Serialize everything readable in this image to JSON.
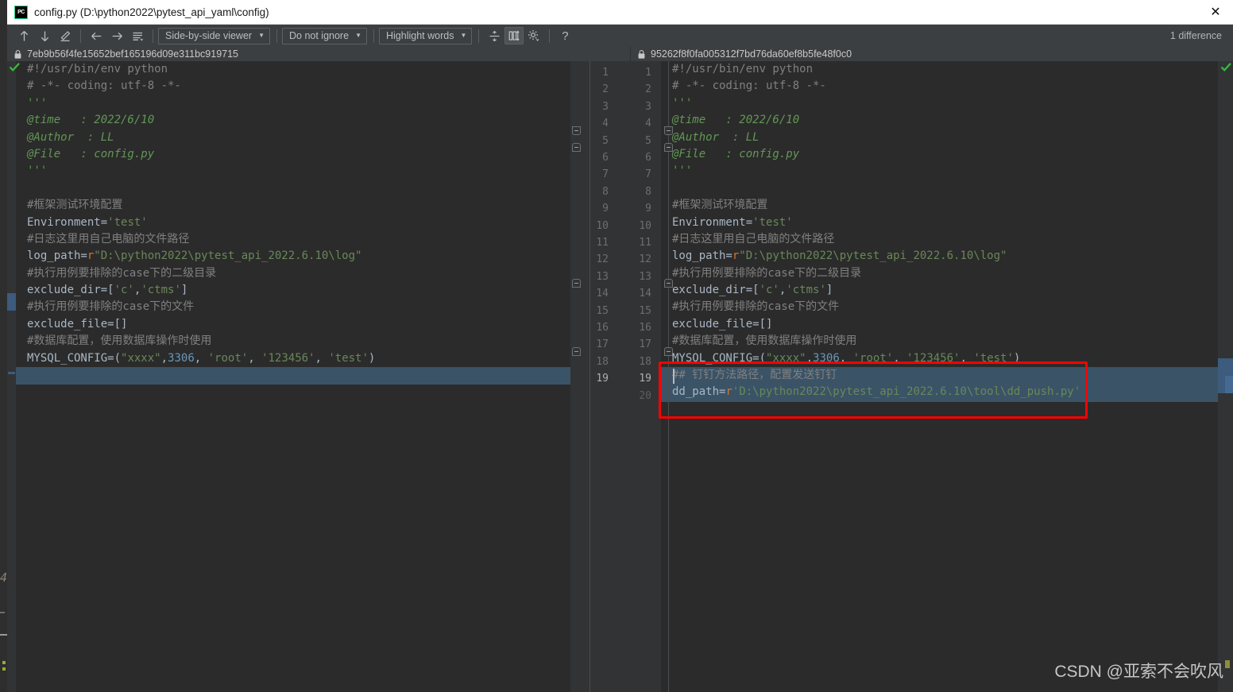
{
  "window": {
    "app_icon": "pycharm-icon",
    "title": "config.py (D:\\python2022\\pytest_api_yaml\\config)",
    "close_label": "✕"
  },
  "toolbar": {
    "prev_diff_icon": "arrow-up-icon",
    "next_diff_icon": "arrow-down-icon",
    "edit_icon": "pencil-icon",
    "accept_left_icon": "arrow-left-icon",
    "accept_right_icon": "arrow-right-icon",
    "lines_icon": "align-lines-icon",
    "viewer_mode": "Side-by-side viewer",
    "ignore_mode": "Do not ignore",
    "highlight_mode": "Highlight words",
    "collapse_icon": "collapse-unchanged-icon",
    "sync_scroll_icon": "synchronize-scroll-icon",
    "settings_icon": "gear-icon",
    "help_icon": "help-question-icon",
    "difference_count": "1 difference"
  },
  "panes": {
    "left": {
      "lock_icon": "lock-icon",
      "revision": "7eb9b56f4fe15652bef165196d09e311bc919715",
      "status_icon": "green-check-icon",
      "lines": [
        {
          "n": 1,
          "tokens": [
            {
              "t": "#!/usr/bin/env python",
              "c": "cmt"
            }
          ]
        },
        {
          "n": 2,
          "tokens": [
            {
              "t": "# -*- coding: utf-8 -*-",
              "c": "cmt"
            }
          ]
        },
        {
          "n": 3,
          "tokens": [
            {
              "t": "'''",
              "c": "doc"
            }
          ]
        },
        {
          "n": 4,
          "tokens": [
            {
              "t": "@time   : 2022/6/10",
              "c": "doc"
            }
          ]
        },
        {
          "n": 5,
          "tokens": [
            {
              "t": "@Author  : LL",
              "c": "doc"
            }
          ]
        },
        {
          "n": 6,
          "tokens": [
            {
              "t": "@File   : config.py",
              "c": "doc"
            }
          ]
        },
        {
          "n": 7,
          "tokens": [
            {
              "t": "'''",
              "c": "doc"
            }
          ]
        },
        {
          "n": 8,
          "tokens": []
        },
        {
          "n": 9,
          "tokens": [
            {
              "t": "#框架测试环境配置",
              "c": "cmt"
            }
          ]
        },
        {
          "n": 10,
          "tokens": [
            {
              "t": "Environment=",
              "c": "id"
            },
            {
              "t": "'test'",
              "c": "str"
            }
          ]
        },
        {
          "n": 11,
          "tokens": [
            {
              "t": "#日志这里用自己电脑的文件路径",
              "c": "cmt"
            }
          ]
        },
        {
          "n": 12,
          "tokens": [
            {
              "t": "log_path=",
              "c": "id"
            },
            {
              "t": "r",
              "c": "pref"
            },
            {
              "t": "\"D:\\python2022\\pytest_api_2022.6.10\\log\"",
              "c": "str"
            }
          ]
        },
        {
          "n": 13,
          "tokens": [
            {
              "t": "#执行用例要排除的case下的二级目录",
              "c": "cmt"
            }
          ]
        },
        {
          "n": 14,
          "tokens": [
            {
              "t": "exclude_dir=[",
              "c": "id"
            },
            {
              "t": "'c'",
              "c": "str"
            },
            {
              "t": ",",
              "c": "id"
            },
            {
              "t": "'ctms'",
              "c": "str"
            },
            {
              "t": "]",
              "c": "id"
            }
          ]
        },
        {
          "n": 15,
          "tokens": [
            {
              "t": "#执行用例要排除的case下的文件",
              "c": "cmt"
            }
          ]
        },
        {
          "n": 16,
          "tokens": [
            {
              "t": "exclude_file=[]",
              "c": "id"
            }
          ]
        },
        {
          "n": 17,
          "tokens": [
            {
              "t": "#数据库配置，使用数据库操作时使用",
              "c": "cmt"
            }
          ]
        },
        {
          "n": 18,
          "tokens": [
            {
              "t": "MYSQL_CONFIG=(",
              "c": "id"
            },
            {
              "t": "\"xxxx\"",
              "c": "str"
            },
            {
              "t": ",",
              "c": "id"
            },
            {
              "t": "3306",
              "c": "num"
            },
            {
              "t": ", ",
              "c": "id"
            },
            {
              "t": "'root'",
              "c": "str"
            },
            {
              "t": ", ",
              "c": "id"
            },
            {
              "t": "'123456'",
              "c": "str"
            },
            {
              "t": ", ",
              "c": "id"
            },
            {
              "t": "'test'",
              "c": "str"
            },
            {
              "t": ")",
              "c": "id"
            }
          ]
        },
        {
          "n": 19,
          "tokens": []
        }
      ]
    },
    "right": {
      "lock_icon": "lock-icon",
      "revision": "95262f8f0fa005312f7bd76da60ef8b5fe48f0c0",
      "status_icon": "green-check-icon",
      "lines": [
        {
          "n": 1,
          "tokens": [
            {
              "t": "#!/usr/bin/env python",
              "c": "cmt"
            }
          ]
        },
        {
          "n": 2,
          "tokens": [
            {
              "t": "# -*- coding: utf-8 -*-",
              "c": "cmt"
            }
          ]
        },
        {
          "n": 3,
          "tokens": [
            {
              "t": "'''",
              "c": "doc"
            }
          ]
        },
        {
          "n": 4,
          "tokens": [
            {
              "t": "@time   : 2022/6/10",
              "c": "doc"
            }
          ]
        },
        {
          "n": 5,
          "tokens": [
            {
              "t": "@Author  : LL",
              "c": "doc"
            }
          ]
        },
        {
          "n": 6,
          "tokens": [
            {
              "t": "@File   : config.py",
              "c": "doc"
            }
          ]
        },
        {
          "n": 7,
          "tokens": [
            {
              "t": "'''",
              "c": "doc"
            }
          ]
        },
        {
          "n": 8,
          "tokens": []
        },
        {
          "n": 9,
          "tokens": [
            {
              "t": "#框架测试环境配置",
              "c": "cmt"
            }
          ]
        },
        {
          "n": 10,
          "tokens": [
            {
              "t": "Environment=",
              "c": "id"
            },
            {
              "t": "'test'",
              "c": "str"
            }
          ]
        },
        {
          "n": 11,
          "tokens": [
            {
              "t": "#日志这里用自己电脑的文件路径",
              "c": "cmt"
            }
          ]
        },
        {
          "n": 12,
          "tokens": [
            {
              "t": "log_path=",
              "c": "id"
            },
            {
              "t": "r",
              "c": "pref"
            },
            {
              "t": "\"D:\\python2022\\pytest_api_2022.6.10\\log\"",
              "c": "str"
            }
          ]
        },
        {
          "n": 13,
          "tokens": [
            {
              "t": "#执行用例要排除的case下的二级目录",
              "c": "cmt"
            }
          ]
        },
        {
          "n": 14,
          "tokens": [
            {
              "t": "exclude_dir=[",
              "c": "id"
            },
            {
              "t": "'c'",
              "c": "str"
            },
            {
              "t": ",",
              "c": "id"
            },
            {
              "t": "'ctms'",
              "c": "str"
            },
            {
              "t": "]",
              "c": "id"
            }
          ]
        },
        {
          "n": 15,
          "tokens": [
            {
              "t": "#执行用例要排除的case下的文件",
              "c": "cmt"
            }
          ]
        },
        {
          "n": 16,
          "tokens": [
            {
              "t": "exclude_file=[]",
              "c": "id"
            }
          ]
        },
        {
          "n": 17,
          "tokens": [
            {
              "t": "#数据库配置，使用数据库操作时使用",
              "c": "cmt"
            }
          ]
        },
        {
          "n": 18,
          "tokens": [
            {
              "t": "MYSQL_CONFIG=(",
              "c": "id"
            },
            {
              "t": "\"xxxx\"",
              "c": "str"
            },
            {
              "t": ",",
              "c": "id"
            },
            {
              "t": "3306",
              "c": "num"
            },
            {
              "t": ", ",
              "c": "id"
            },
            {
              "t": "'root'",
              "c": "str"
            },
            {
              "t": ", ",
              "c": "id"
            },
            {
              "t": "'123456'",
              "c": "str"
            },
            {
              "t": ", ",
              "c": "id"
            },
            {
              "t": "'test'",
              "c": "str"
            },
            {
              "t": ")",
              "c": "id"
            }
          ]
        },
        {
          "n": 19,
          "tokens": [
            {
              "t": "## 钉钉方法路径，配置发送钉钉",
              "c": "cmt"
            }
          ]
        },
        {
          "n": 20,
          "tokens": [
            {
              "t": "dd_path=",
              "c": "id"
            },
            {
              "t": "r",
              "c": "pref"
            },
            {
              "t": "'D:\\python2022\\pytest_api_2022.6.10\\tool\\dd_push.py'",
              "c": "str"
            }
          ]
        }
      ]
    }
  },
  "annotation": {
    "redbox_label": "inserted-lines-highlight",
    "color": "#ff0000"
  },
  "watermark": {
    "text": "CSDN @亚索不会吹风"
  },
  "colors": {
    "editor_bg": "#2b2b2b",
    "gutter_bg": "#313335",
    "toolbar_bg": "#3c3f41",
    "diff_highlight": "#3b5366",
    "accent_red": "#ff0000",
    "status_green": "#38b83a"
  }
}
